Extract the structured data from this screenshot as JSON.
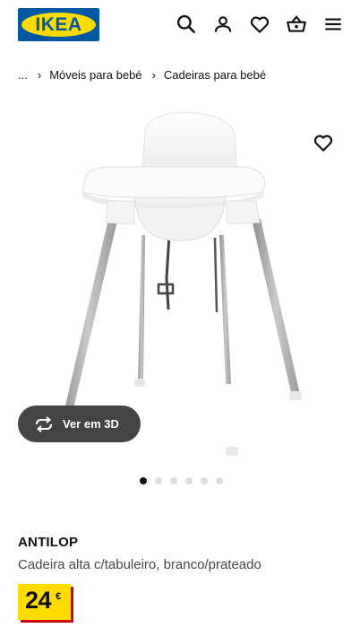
{
  "header": {
    "logo_text": "IKEA",
    "icons": [
      "search-icon",
      "user-icon",
      "heart-icon",
      "basket-icon",
      "menu-icon"
    ]
  },
  "breadcrumb": {
    "ellipsis": "...",
    "items": [
      "Móveis para bebé",
      "Cadeiras para bebé"
    ],
    "separator": "›"
  },
  "product": {
    "view_3d_label": "Ver em 3D",
    "carousel": {
      "total": 6,
      "active": 1
    },
    "name": "ANTILOP",
    "description": "Cadeira alta c/tabuleiro, branco/prateado",
    "price_integer": "24",
    "price_currency": "€"
  },
  "colors": {
    "brand_blue": "#0058a3",
    "brand_yellow": "#ffdb00",
    "price_shadow": "#cc0008",
    "button_3d": "#444444"
  }
}
